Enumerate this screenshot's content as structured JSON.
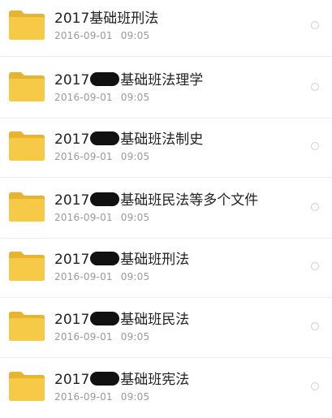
{
  "files": [
    {
      "prefix": "2017",
      "suffix": "基础班刑法",
      "date": "2016-09-01",
      "time": "09:05",
      "icon": "folder-icon"
    },
    {
      "prefix": "2017",
      "suffix": "基础班法理学",
      "date": "2016-09-01",
      "time": "09:05",
      "icon": "folder-icon"
    },
    {
      "prefix": "2017",
      "suffix": "基础班法制史",
      "date": "2016-09-01",
      "time": "09:05",
      "icon": "folder-icon"
    },
    {
      "prefix": "2017",
      "suffix": "基础班民法等多个文件",
      "date": "2016-09-01",
      "time": "09:05",
      "icon": "folder-icon"
    },
    {
      "prefix": "2017",
      "suffix": "基础班刑法",
      "date": "2016-09-01",
      "time": "09:05",
      "icon": "folder-icon"
    },
    {
      "prefix": "2017",
      "suffix": "基础班民法",
      "date": "2016-09-01",
      "time": "09:05",
      "icon": "folder-icon"
    },
    {
      "prefix": "2017",
      "suffix": "基础班宪法",
      "date": "2016-09-01",
      "time": "09:05",
      "icon": "folder-icon"
    }
  ],
  "colors": {
    "folder_body": "#F6C947",
    "folder_tab": "#E8B42F",
    "divider": "#ECECEC",
    "date_text": "#9A9A9A"
  }
}
